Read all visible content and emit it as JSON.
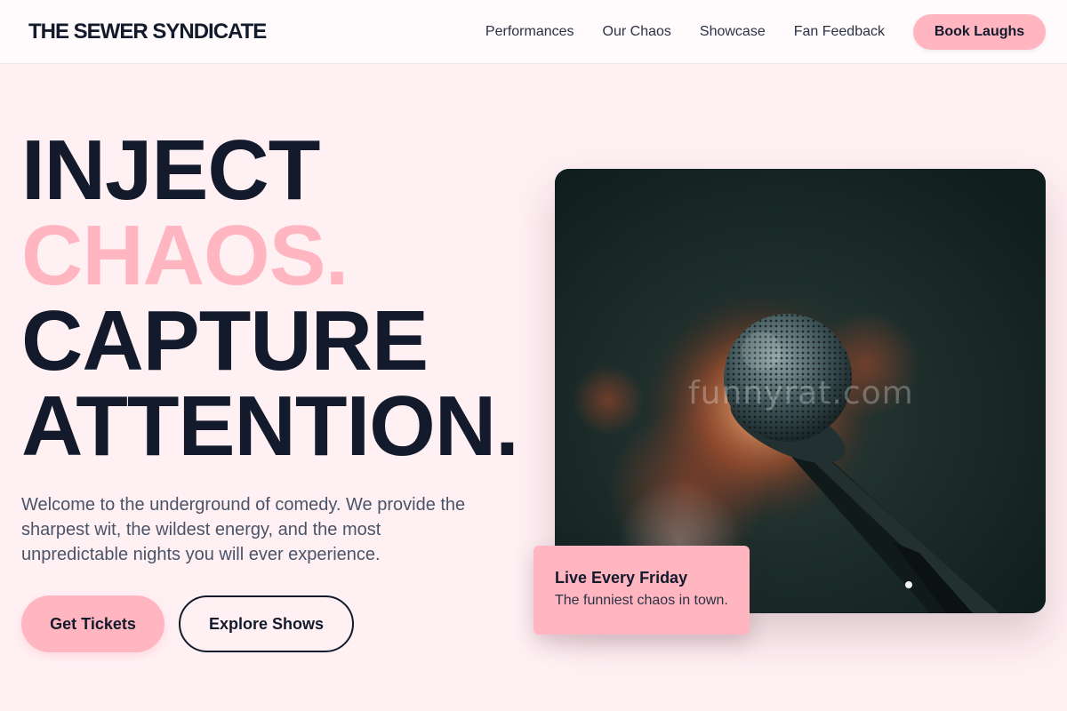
{
  "brand": "THE SEWER SYNDICATE",
  "nav": {
    "items": [
      "Performances",
      "Our Chaos",
      "Showcase",
      "Fan Feedback"
    ],
    "cta": "Book Laughs"
  },
  "hero": {
    "line1": "INJECT",
    "line2": "CHAOS.",
    "line3": "CAPTURE",
    "line4": "ATTENTION.",
    "description": "Welcome to the underground of comedy. We provide the sharpest wit, the wildest energy, and the most unpredictable nights you will ever experience.",
    "primary_button": "Get Tickets",
    "secondary_button": "Explore Shows"
  },
  "image": {
    "subject": "microphone",
    "watermark": "funnyrat.com"
  },
  "info_card": {
    "title": "Live Every Friday",
    "subtitle": "The funniest chaos in town."
  },
  "colors": {
    "accent": "#ffb6c1",
    "background": "#fff0f4",
    "text": "#121a2c"
  }
}
